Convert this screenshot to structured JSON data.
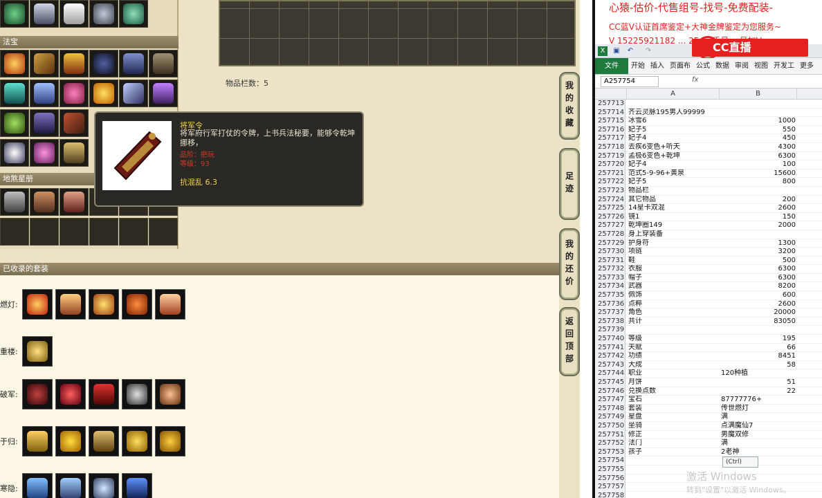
{
  "left_panel": {
    "section_fabao": "法宝",
    "section_disha": "地煞星册"
  },
  "inventory": {
    "count_label": "物品栏数：5"
  },
  "tooltip": {
    "title": "将军令",
    "desc": "将军府行军打仗的令牌，上书兵法秘要，能够令乾坤挪移，",
    "red1": "品阶：把玩",
    "red2": "等级：93",
    "stat": "抗混乱 6.3"
  },
  "side_tabs": [
    "我的收藏",
    "足迹",
    "我的还价",
    "返回顶部"
  ],
  "collected": {
    "title": "已收录的套装",
    "sets": [
      {
        "label": "燃灯:",
        "count": 5
      },
      {
        "label": "重楼:",
        "count": 1
      },
      {
        "label": "破军:",
        "count": 5
      },
      {
        "label": "于归:",
        "count": 5
      },
      {
        "label": "寒隐:",
        "count": 4
      }
    ]
  },
  "banner": {
    "line1": "心猿-估价-代售组号-找号-免费配装-",
    "line2": "CC蓝V认证首席鉴定+大神金牌鉴定为您服务~",
    "line3": "V 15225921182 ... 25 ... 手号... 号加V",
    "logo": "CC直播"
  },
  "excel": {
    "tabs": [
      "文件",
      "开始",
      "插入",
      "页面布",
      "公式",
      "数据",
      "审阅",
      "视图",
      "开发工",
      "更多"
    ],
    "name_box": "A257754",
    "fx": "fx",
    "col_a": "A",
    "col_b": "B",
    "paste_option": "(Ctrl)",
    "rows": [
      {
        "n": "257713",
        "a": "",
        "b": ""
      },
      {
        "n": "257714",
        "a": "齐云灵脉195男人99999",
        "b": ""
      },
      {
        "n": "257715",
        "a": "冰雪6",
        "b": "1000"
      },
      {
        "n": "257716",
        "a": "妃子5",
        "b": "550"
      },
      {
        "n": "257717",
        "a": "妃子4",
        "b": "450"
      },
      {
        "n": "257718",
        "a": "去疾6变色+听天",
        "b": "4300"
      },
      {
        "n": "257719",
        "a": "孟极6变色+乾坤",
        "b": "6300"
      },
      {
        "n": "257720",
        "a": "妃子4",
        "b": "100"
      },
      {
        "n": "257721",
        "a": "范式5-9-96+黄泉",
        "b": "15600"
      },
      {
        "n": "257722",
        "a": "妃子5",
        "b": "800"
      },
      {
        "n": "257723",
        "a": "物品栏",
        "b": ""
      },
      {
        "n": "257724",
        "a": "其它物品",
        "b": "200"
      },
      {
        "n": "257725",
        "a": "14星卡双混",
        "b": "2600"
      },
      {
        "n": "257726",
        "a": "镜1",
        "b": "150"
      },
      {
        "n": "257727",
        "a": "乾坤圈149",
        "b": "2000"
      },
      {
        "n": "257728",
        "a": "身上穿装备",
        "b": ""
      },
      {
        "n": "257729",
        "a": "护身符",
        "b": "1300"
      },
      {
        "n": "257730",
        "a": "项链",
        "b": "3200"
      },
      {
        "n": "257731",
        "a": "鞋",
        "b": "500"
      },
      {
        "n": "257732",
        "a": "衣服",
        "b": "6300"
      },
      {
        "n": "257733",
        "a": "帽子",
        "b": "6300"
      },
      {
        "n": "257734",
        "a": "武器",
        "b": "8200"
      },
      {
        "n": "257735",
        "a": "佩饰",
        "b": "600"
      },
      {
        "n": "257736",
        "a": "点粹",
        "b": "2600"
      },
      {
        "n": "257737",
        "a": "角色",
        "b": "20000"
      },
      {
        "n": "257738",
        "a": "共计",
        "b": "83050"
      },
      {
        "n": "257739",
        "a": "",
        "b": ""
      },
      {
        "n": "257740",
        "a": "等级",
        "b": "195"
      },
      {
        "n": "257741",
        "a": "天赋",
        "b": "66"
      },
      {
        "n": "257742",
        "a": "功绩",
        "b": "8451"
      },
      {
        "n": "257743",
        "a": "大成",
        "b": "58"
      },
      {
        "n": "257744",
        "a": "职业",
        "b": "120种植",
        "t": true
      },
      {
        "n": "257745",
        "a": "月饼",
        "b": "51"
      },
      {
        "n": "257746",
        "a": "兑换点数",
        "b": "22"
      },
      {
        "n": "257747",
        "a": "宝石",
        "b": "87777776+",
        "t": true
      },
      {
        "n": "257748",
        "a": "套装",
        "b": "传世燃灯",
        "t": true
      },
      {
        "n": "257749",
        "a": "星盘",
        "b": "满",
        "t": true
      },
      {
        "n": "257750",
        "a": "坐骑",
        "b": "点满魔仙7",
        "t": true
      },
      {
        "n": "257751",
        "a": "修正",
        "b": "男魔双修",
        "t": true
      },
      {
        "n": "257752",
        "a": "法门",
        "b": "满",
        "t": true
      },
      {
        "n": "257753",
        "a": "孩子",
        "b": "2老神",
        "t": true
      },
      {
        "n": "257754",
        "a": "",
        "b": ""
      },
      {
        "n": "257755",
        "a": "",
        "b": ""
      },
      {
        "n": "257756",
        "a": "",
        "b": ""
      },
      {
        "n": "257757",
        "a": "",
        "b": ""
      },
      {
        "n": "257758",
        "a": "",
        "b": ""
      }
    ]
  },
  "watermark": {
    "line1": "激活 Windows",
    "line2": "转到\"设置\"以激活 Windows。"
  },
  "colors": {
    "accent_red": "#e42020",
    "excel_green": "#1f7a3d",
    "tooltip_gold": "#f2d44a"
  }
}
